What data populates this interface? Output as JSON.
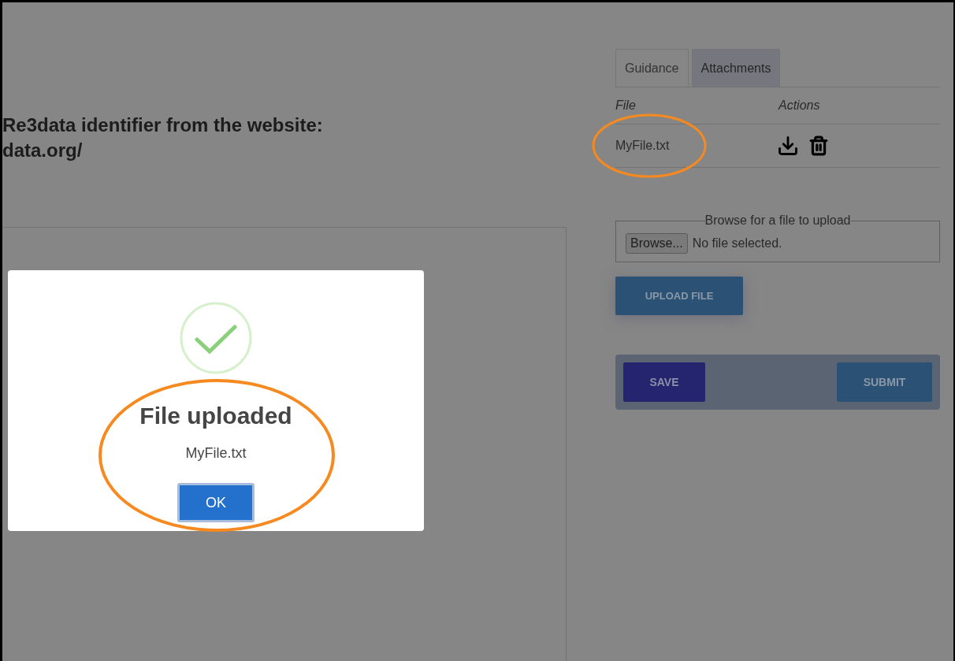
{
  "heading_lines": [
    "Re3data identifier from the website:",
    "data.org/"
  ],
  "sidebar": {
    "tabs": [
      {
        "label": "Guidance",
        "selected": false
      },
      {
        "label": "Attachments",
        "selected": true
      }
    ],
    "attachments": {
      "columns": [
        "File",
        "Actions"
      ],
      "rows": [
        {
          "file": "MyFile.txt"
        }
      ]
    },
    "upload": {
      "legend": "Browse for a file to upload",
      "browse_button": "Browse...",
      "file_status": "No file selected.",
      "upload_button": "UPLOAD FILE"
    },
    "actions": {
      "save": "SAVE",
      "submit": "SUBMIT"
    }
  },
  "dialog": {
    "title": "File uploaded",
    "message": "MyFile.txt",
    "ok_button": "OK"
  }
}
